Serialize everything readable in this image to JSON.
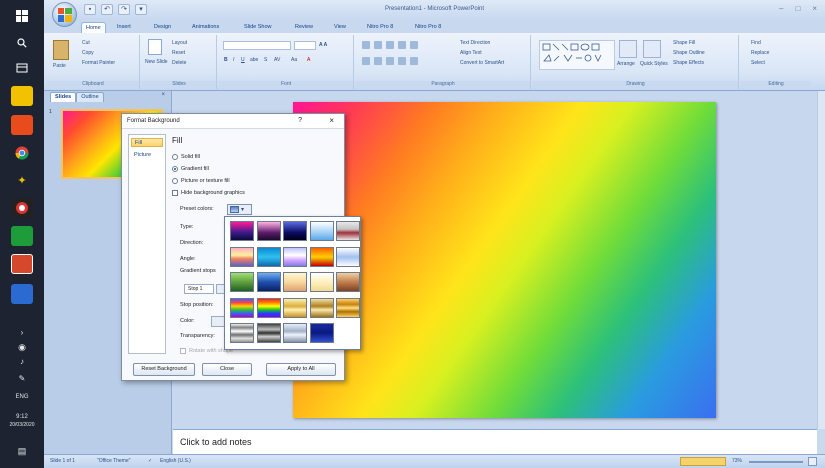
{
  "window": {
    "title": "Presentation1 - Microsoft PowerPoint",
    "controls": [
      "–",
      "□",
      "×"
    ]
  },
  "quick_access": [
    "save-icon",
    "undo-icon",
    "redo-icon",
    "customize-icon"
  ],
  "tabs": [
    "Home",
    "Insert",
    "Design",
    "Animations",
    "Slide Show",
    "Review",
    "View",
    "Nitro Pro 8",
    "Nitro Pro 8"
  ],
  "ribbon": {
    "clipboard": {
      "label": "Clipboard",
      "paste": "Paste",
      "cut": "Cut",
      "copy": "Copy",
      "format_painter": "Format Painter"
    },
    "slides": {
      "label": "Slides",
      "new_slide": "New Slide",
      "layout": "Layout",
      "reset": "Reset",
      "delete": "Delete"
    },
    "font": {
      "label": "Font"
    },
    "paragraph": {
      "label": "Paragraph",
      "text_direction": "Text Direction",
      "align_text": "Align Text",
      "convert_smartart": "Convert to SmartArt"
    },
    "drawing": {
      "label": "Drawing",
      "arrange": "Arrange",
      "quick_styles": "Quick Styles",
      "shape_fill": "Shape Fill",
      "shape_outline": "Shape Outline",
      "shape_effects": "Shape Effects"
    },
    "editing": {
      "label": "Editing",
      "find": "Find",
      "replace": "Replace",
      "select": "Select"
    }
  },
  "left_panel": {
    "tabs": [
      "Slides",
      "Outline"
    ],
    "close": "×",
    "slide_number": "1"
  },
  "notes_placeholder": "Click to add notes",
  "status": {
    "slide": "Slide 1 of 1",
    "theme": "\"Office Theme\"",
    "language": "English (U.S.)",
    "zoom": "73%"
  },
  "taskbar": {
    "language": "ENG",
    "time": "9:12",
    "date": "20/03/2020"
  },
  "dialog": {
    "title": "Format Background",
    "help": "?",
    "close": "×",
    "nav": [
      "Fill",
      "Picture"
    ],
    "section": "Fill",
    "fill_options": [
      "Solid fill",
      "Gradient fill",
      "Picture or texture fill"
    ],
    "selected_fill": "Gradient fill",
    "hide_graphics": "Hide background graphics",
    "preset_colors": "Preset colors:",
    "type": "Type:",
    "direction": "Direction:",
    "angle": "Angle:",
    "gradient_stops": "Gradient stops",
    "stop_value": "Stop 1",
    "stop_position": "Stop position:",
    "color": "Color:",
    "transparency": "Transparency:",
    "rotate_with_shape": "Rotate with shape",
    "buttons": {
      "reset": "Reset Background",
      "close": "Close",
      "apply_all": "Apply to All"
    }
  },
  "preset_gallery": [
    [
      "linear-gradient(#ff1a9a, #3a1a8a 60%, #0a0a3a)",
      "linear-gradient(#ffb2e0, #5a1a6a 60%, #1a0a2a)",
      "linear-gradient(#5a6ae0, #0a0a60 60%, #00001a)",
      "linear-gradient(#ffffff, #9fd0f5 60%, #5aa6e8)",
      "linear-gradient(#e8e8e8, #c4c4c4 40%, #a0303a 60%, #e8e8e8)"
    ],
    [
      "linear-gradient(#ffb0c0, #fff0a0 40%, #f08060 60%, #6060c0)",
      "linear-gradient(#0a8ad0, #30c0f0 50%, #0a6ab0)",
      "linear-gradient(#c0c0ff, #ffffff 40%, #d0a0ff 70%, #8080e0)",
      "linear-gradient(#ff6000, #ffd000 50%, #c00000)",
      "linear-gradient(#ffffff, #a0c0f0 50%, #ffffff)"
    ],
    [
      "linear-gradient(#a0e070, #60a040 50%, #206020)",
      "linear-gradient(#70b0f0, #2050b0 50%, #0a2060)",
      "linear-gradient(#fff8d0, #f8d8a0 50%, #e0a070)",
      "linear-gradient(#ffffff, #fff0c0 50%, #f0d890)",
      "linear-gradient(#f0d0a0, #c08050 50%, #804020)"
    ],
    [
      "linear-gradient(#4060ff, #ff4040 20%, #ffd000 40%, #30c030 60%, #3060ff 80%, #c000c0)",
      "linear-gradient(#ff2020, #ff8000 20%, #ffff00 40%, #20c020 60%, #2040ff 80%, #8000ff)",
      "linear-gradient(#fff0b0, #d8b040 40%, #fff0b0 60%, #c89020)",
      "linear-gradient(#f0e0a0, #b08020 40%, #f8e8b0 60%, #a07010)",
      "linear-gradient(#ffd060, #c88010 30%, #ffe080 50%, #b07000 70%, #ffd060)"
    ],
    [
      "linear-gradient(#f0f0f0, #808080 20%, #ffffff 40%, #707070 60%, #e0e0e0 80%, #909090)",
      "linear-gradient(#404040, #c0c0c0 30%, #303030 50%, #d0d0d0 70%, #404040)",
      "linear-gradient(#e8eef8, #a0b0c8 40%, #f0f4fa 60%, #8090a8)",
      "linear-gradient(#1a2aa0, #0a1a80 50%, #3050d0)"
    ]
  ]
}
